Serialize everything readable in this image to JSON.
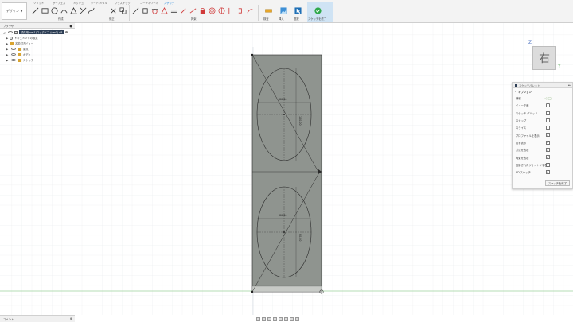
{
  "toolbar": {
    "workspace_label": "デザイン",
    "tabs": [
      "ソリッド",
      "サーフェス",
      "メッシュ",
      "シート メタル",
      "プラスチック",
      "ユーティリティ",
      "スケッチ"
    ],
    "active_tab": "スケッチ",
    "groups": [
      "作成",
      "修正",
      "拘束",
      "検査",
      "挿入",
      "選択",
      "スケッチを終了"
    ]
  },
  "browser": {
    "title": "ブラウザ",
    "root_label": "試作用(ver1)ロックノブ (ver1) v8",
    "items": [
      {
        "label": "ドキュメントの設定"
      },
      {
        "label": "名前付きビュー"
      },
      {
        "label": "原点"
      },
      {
        "label": "ボディ"
      },
      {
        "label": "スケッチ"
      }
    ]
  },
  "bottom_panel": {
    "title": "コメント"
  },
  "viewcube": {
    "face_label": "右",
    "axis_z": "Z",
    "axis_y": "Y"
  },
  "palette": {
    "title": "スケッチパレット",
    "section": "オプション",
    "rows": [
      {
        "label": "線種",
        "control": "icons",
        "checked": false
      },
      {
        "label": "ビュー正面",
        "control": "icon",
        "checked": false
      },
      {
        "label": "スケッチ グリッド",
        "control": "checkbox",
        "checked": false
      },
      {
        "label": "スナップ",
        "control": "checkbox",
        "checked": false
      },
      {
        "label": "スライス",
        "control": "checkbox",
        "checked": false
      },
      {
        "label": "プロファイルを表示",
        "control": "checkbox",
        "checked": true
      },
      {
        "label": "点を表示",
        "control": "checkbox",
        "checked": true
      },
      {
        "label": "寸法を表示",
        "control": "checkbox",
        "checked": true
      },
      {
        "label": "拘束を表示",
        "control": "checkbox",
        "checked": true
      },
      {
        "label": "投影されたジオメトリを表示",
        "control": "checkbox",
        "checked": true
      },
      {
        "label": "3D スケッチ",
        "control": "checkbox",
        "checked": true
      }
    ],
    "finish_button": "スケッチを終了"
  },
  "sketch": {
    "dimensions": {
      "upper_width": "80.00",
      "upper_height": "100.00",
      "lower_width": "80.00",
      "lower_height": "80.00"
    }
  },
  "colors": {
    "accent": "#0a7ad8",
    "body_fill": "#8f948f",
    "sketch_line": "#2a2a2a",
    "grid": "#e2e4e6"
  }
}
